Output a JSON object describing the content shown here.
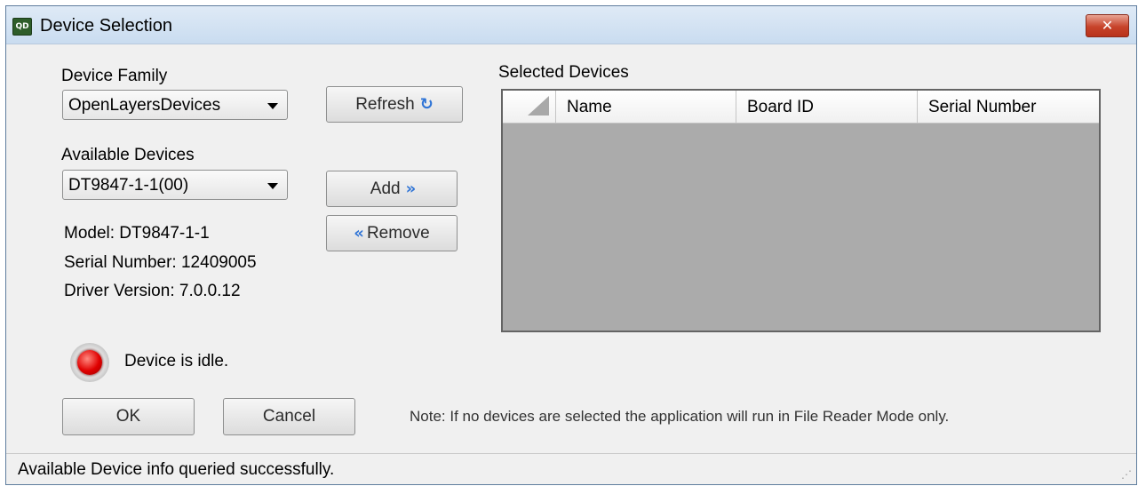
{
  "window": {
    "title": "Device Selection",
    "app_icon": "QD",
    "close_glyph": "✕"
  },
  "device_family": {
    "label": "Device Family",
    "selected": "OpenLayersDevices"
  },
  "available_devices": {
    "label": "Available Devices",
    "selected": "DT9847-1-1(00)"
  },
  "device_info": {
    "model": "Model: DT9847-1-1",
    "serial": "Serial Number: 12409005",
    "driver": "Driver Version: 7.0.0.12"
  },
  "buttons": {
    "refresh": "Refresh",
    "add": "Add",
    "remove": "Remove",
    "ok": "OK",
    "cancel": "Cancel"
  },
  "icons": {
    "refresh": "↻",
    "add_chevron": "»",
    "remove_chevron": "«",
    "status_led": "red-led-icon",
    "grip": "⋰"
  },
  "selected_devices": {
    "label": "Selected Devices",
    "columns": [
      "Name",
      "Board ID",
      "Serial Number"
    ],
    "rows": []
  },
  "device_status": "Device is idle.",
  "note": "Note: If no devices are selected the application will run in File Reader Mode only.",
  "status_bar": "Available Device info queried successfully.",
  "colors": {
    "accent": "#2f74d6",
    "led": "#e00000",
    "grid_background": "#ababab",
    "close_button": "#c7432a"
  }
}
